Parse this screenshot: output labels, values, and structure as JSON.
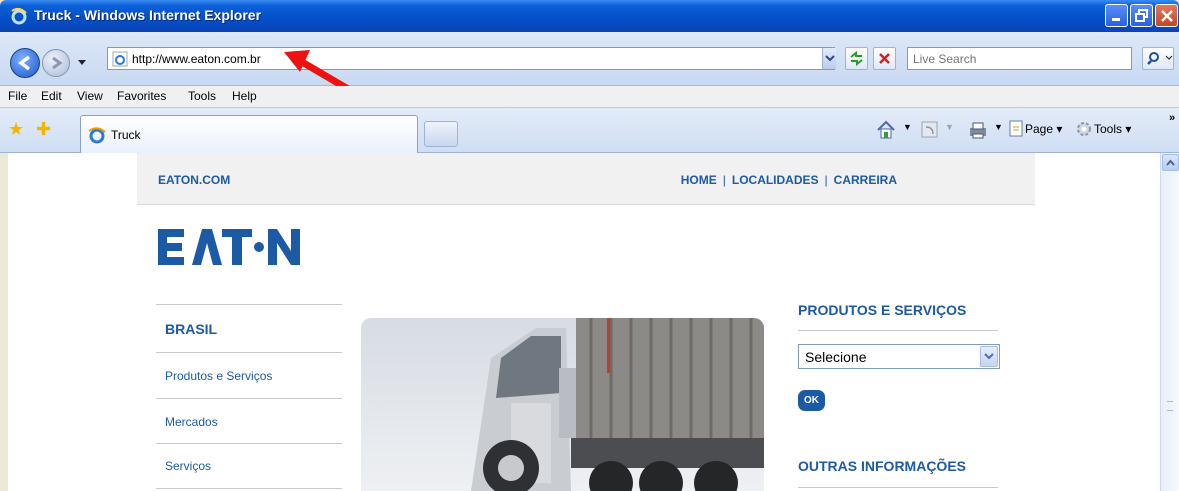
{
  "window": {
    "title": "Truck - Windows Internet Explorer"
  },
  "address_bar": {
    "url": "http://www.eaton.com.br",
    "search_placeholder": "Live Search"
  },
  "menu": {
    "items": [
      "File",
      "Edit",
      "View",
      "Favorites",
      "Tools",
      "Help"
    ]
  },
  "tabs": {
    "active_label": "Truck"
  },
  "toolbar": {
    "page_label": "Page",
    "tools_label": "Tools"
  },
  "site": {
    "header_link": "EATON.COM",
    "top_nav": [
      "HOME",
      "LOCALIDADES",
      "CARREIRA"
    ],
    "left_menu": {
      "title": "BRASIL",
      "items": [
        "Produtos e Serviços",
        "Mercados",
        "Serviços"
      ]
    },
    "products": {
      "title": "PRODUTOS E SERVIÇOS",
      "select_value": "Selecione",
      "ok_label": "OK"
    },
    "other_info": {
      "title": "OUTRAS INFORMAÇÕES"
    },
    "brand_color": "#1d5aa6"
  }
}
